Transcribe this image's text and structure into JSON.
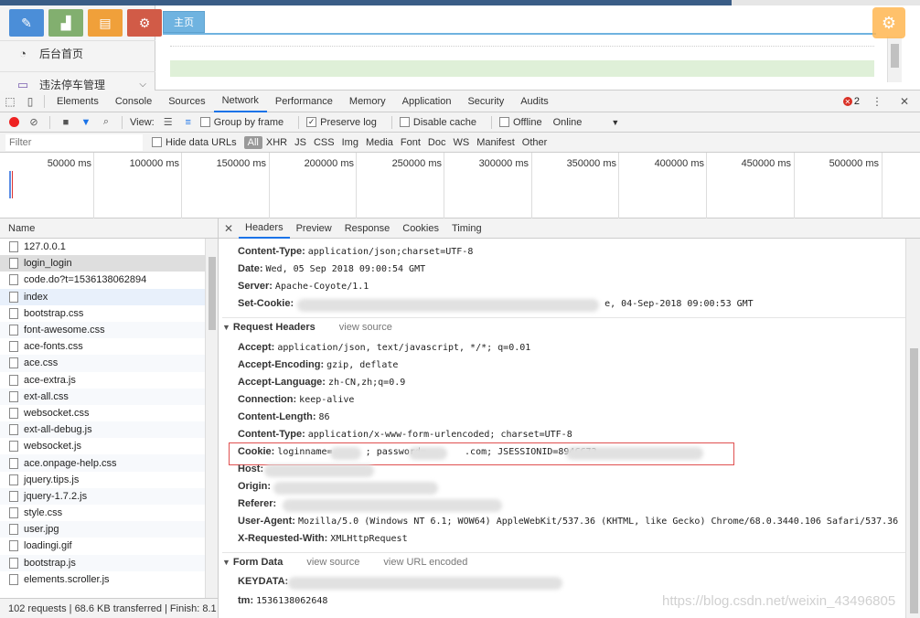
{
  "app": {
    "tab_main": "主页",
    "nav": [
      {
        "label": "后台首页"
      },
      {
        "label": "违法停车管理"
      }
    ]
  },
  "devtools": {
    "tabs": [
      "Elements",
      "Console",
      "Sources",
      "Network",
      "Performance",
      "Memory",
      "Application",
      "Security",
      "Audits"
    ],
    "active_tab": "Network",
    "error_count": "2",
    "toolbar": {
      "view_label": "View:",
      "group_by_frame": "Group by frame",
      "preserve_log": "Preserve log",
      "disable_cache": "Disable cache",
      "offline": "Offline",
      "throttle": "Online"
    },
    "filter": {
      "placeholder": "Filter",
      "hide_data_urls": "Hide data URLs",
      "types": [
        "All",
        "XHR",
        "JS",
        "CSS",
        "Img",
        "Media",
        "Font",
        "Doc",
        "WS",
        "Manifest",
        "Other"
      ]
    },
    "timeline_ticks": [
      "50000 ms",
      "100000 ms",
      "150000 ms",
      "200000 ms",
      "250000 ms",
      "300000 ms",
      "350000 ms",
      "400000 ms",
      "450000 ms",
      "500000 ms"
    ],
    "list_header": "Name",
    "requests": [
      "127.0.0.1",
      "login_login",
      "code.do?t=1536138062894",
      "index",
      "bootstrap.css",
      "font-awesome.css",
      "ace-fonts.css",
      "ace.css",
      "ace-extra.js",
      "ext-all.css",
      "websocket.css",
      "ext-all-debug.js",
      "websocket.js",
      "ace.onpage-help.css",
      "jquery.tips.js",
      "jquery-1.7.2.js",
      "style.css",
      "user.jpg",
      "loadingi.gif",
      "bootstrap.js",
      "elements.scroller.js"
    ],
    "status_bar": "102 requests | 68.6 KB transferred | Finish: 8.1 ...",
    "detail_tabs": [
      "Headers",
      "Preview",
      "Response",
      "Cookies",
      "Timing"
    ],
    "response_headers": [
      {
        "k": "Content-Type:",
        "v": "application/json;charset=UTF-8"
      },
      {
        "k": "Date:",
        "v": "Wed, 05 Sep 2018 09:00:54 GMT"
      },
      {
        "k": "Server:",
        "v": "Apache-Coyote/1.1"
      },
      {
        "k": "Set-Cookie:",
        "v": "e, 04-Sep-2018 09:00:53 GMT"
      }
    ],
    "request_section": {
      "title": "Request Headers",
      "view_source": "view source"
    },
    "request_headers": [
      {
        "k": "Accept:",
        "v": "application/json, text/javascript, */*; q=0.01"
      },
      {
        "k": "Accept-Encoding:",
        "v": "gzip, deflate"
      },
      {
        "k": "Accept-Language:",
        "v": "zh-CN,zh;q=0.9"
      },
      {
        "k": "Connection:",
        "v": "keep-alive"
      },
      {
        "k": "Content-Length:",
        "v": "86"
      },
      {
        "k": "Content-Type:",
        "v": "application/x-www-form-urlencoded; charset=UTF-8"
      },
      {
        "k": "Cookie:",
        "v": "loginname=      ; password=       .com; JSESSIONID=894CC72"
      },
      {
        "k": "Host:",
        "v": ""
      },
      {
        "k": "Origin:",
        "v": ""
      },
      {
        "k": "Referer:",
        "v": ""
      },
      {
        "k": "User-Agent:",
        "v": "Mozilla/5.0 (Windows NT 6.1; WOW64) AppleWebKit/537.36 (KHTML, like Gecko) Chrome/68.0.3440.106 Safari/537.36"
      },
      {
        "k": "X-Requested-With:",
        "v": "XMLHttpRequest"
      }
    ],
    "form_section": {
      "title": "Form Data",
      "view_source": "view source",
      "view_url": "view URL encoded"
    },
    "form_data": [
      {
        "k": "KEYDATA:",
        "v": ""
      },
      {
        "k": "tm:",
        "v": "1536138062648"
      }
    ]
  },
  "watermark": "https://blog.csdn.net/weixin_43496805"
}
